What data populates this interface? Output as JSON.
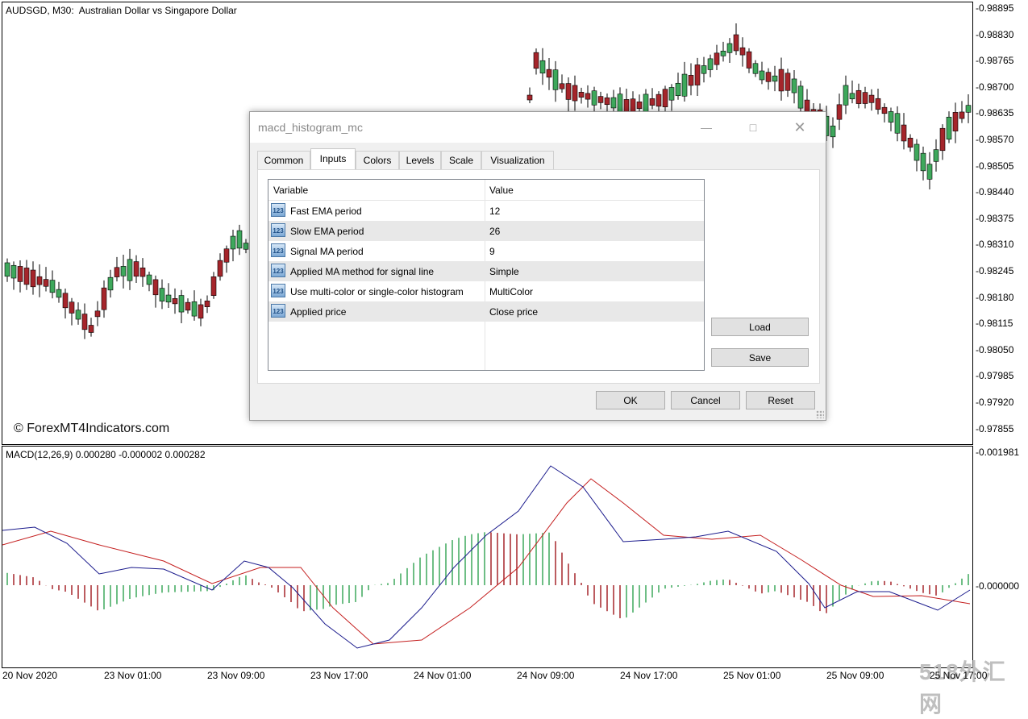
{
  "chart": {
    "title": "AUDSGD, M30:  Australian Dollar vs Singapore Dollar",
    "watermark": "© ForexMT4Indicators.com",
    "price_labels": [
      "0.98895",
      "0.98830",
      "0.98765",
      "0.98700",
      "0.98635",
      "0.98570",
      "0.98505",
      "0.98440",
      "0.98375",
      "0.98310",
      "0.98245",
      "0.98180",
      "0.98115",
      "0.98050",
      "0.97985",
      "0.97920",
      "0.97855"
    ],
    "indicator_label": "MACD(12,26,9) 0.000280 -0.000002 0.000282",
    "indicator_scale": [
      "0.001981",
      "0.000000"
    ],
    "time_labels": [
      "20 Nov 2020",
      "23 Nov 01:00",
      "23 Nov 09:00",
      "23 Nov 17:00",
      "24 Nov 01:00",
      "24 Nov 09:00",
      "24 Nov 17:00",
      "25 Nov 01:00",
      "25 Nov 09:00",
      "25 Nov 17:00"
    ],
    "site_logo": "518外汇网",
    "colors": {
      "bull": "#3ea85c",
      "bear": "#a5252b",
      "macd_line": "#1a1a8c",
      "signal_line": "#c41e1e"
    }
  },
  "dialog": {
    "title": "macd_histogram_mc",
    "tabs": [
      "Common",
      "Inputs",
      "Colors",
      "Levels",
      "Scale",
      "Visualization"
    ],
    "active_tab": "Inputs",
    "columns": {
      "variable": "Variable",
      "value": "Value"
    },
    "rows": [
      {
        "icon": "123",
        "variable": "Fast EMA period",
        "value": "12"
      },
      {
        "icon": "123",
        "variable": "Slow EMA period",
        "value": "26"
      },
      {
        "icon": "123",
        "variable": "Signal MA period",
        "value": "9"
      },
      {
        "icon": "123",
        "variable": "Applied MA method for signal line",
        "value": "Simple"
      },
      {
        "icon": "123",
        "variable": "Use multi-color or single-color histogram",
        "value": "MultiColor"
      },
      {
        "icon": "123",
        "variable": "Applied price",
        "value": "Close price"
      }
    ],
    "buttons": {
      "load": "Load",
      "save": "Save",
      "ok": "OK",
      "cancel": "Cancel",
      "reset": "Reset"
    }
  }
}
